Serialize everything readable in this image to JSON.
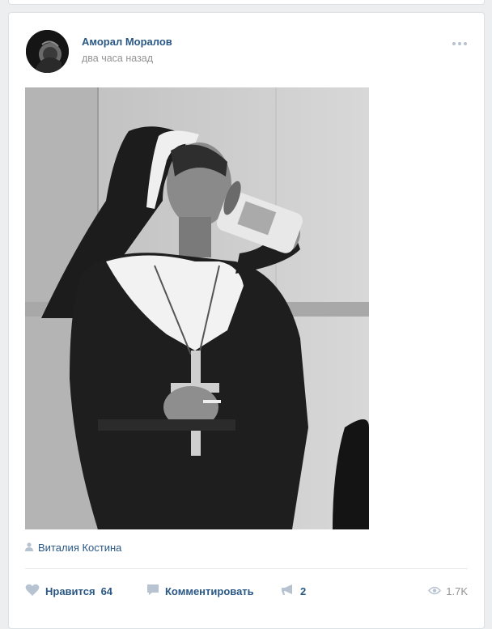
{
  "post": {
    "author": "Аморал Моралов",
    "time": "два часа назад",
    "signature": "Виталия Костина",
    "actions": {
      "like_label": "Нравится",
      "like_count": "64",
      "comment_label": "Комментировать",
      "share_count": "2",
      "views": "1.7K"
    },
    "icons": {
      "more": "more-dots-icon",
      "signer": "user-icon",
      "like": "heart-icon",
      "comment": "comment-icon",
      "share": "megaphone-icon",
      "views": "eye-icon"
    },
    "colors": {
      "link": "#2a5885",
      "muted": "#939393",
      "icon": "#b8c3d1"
    }
  }
}
